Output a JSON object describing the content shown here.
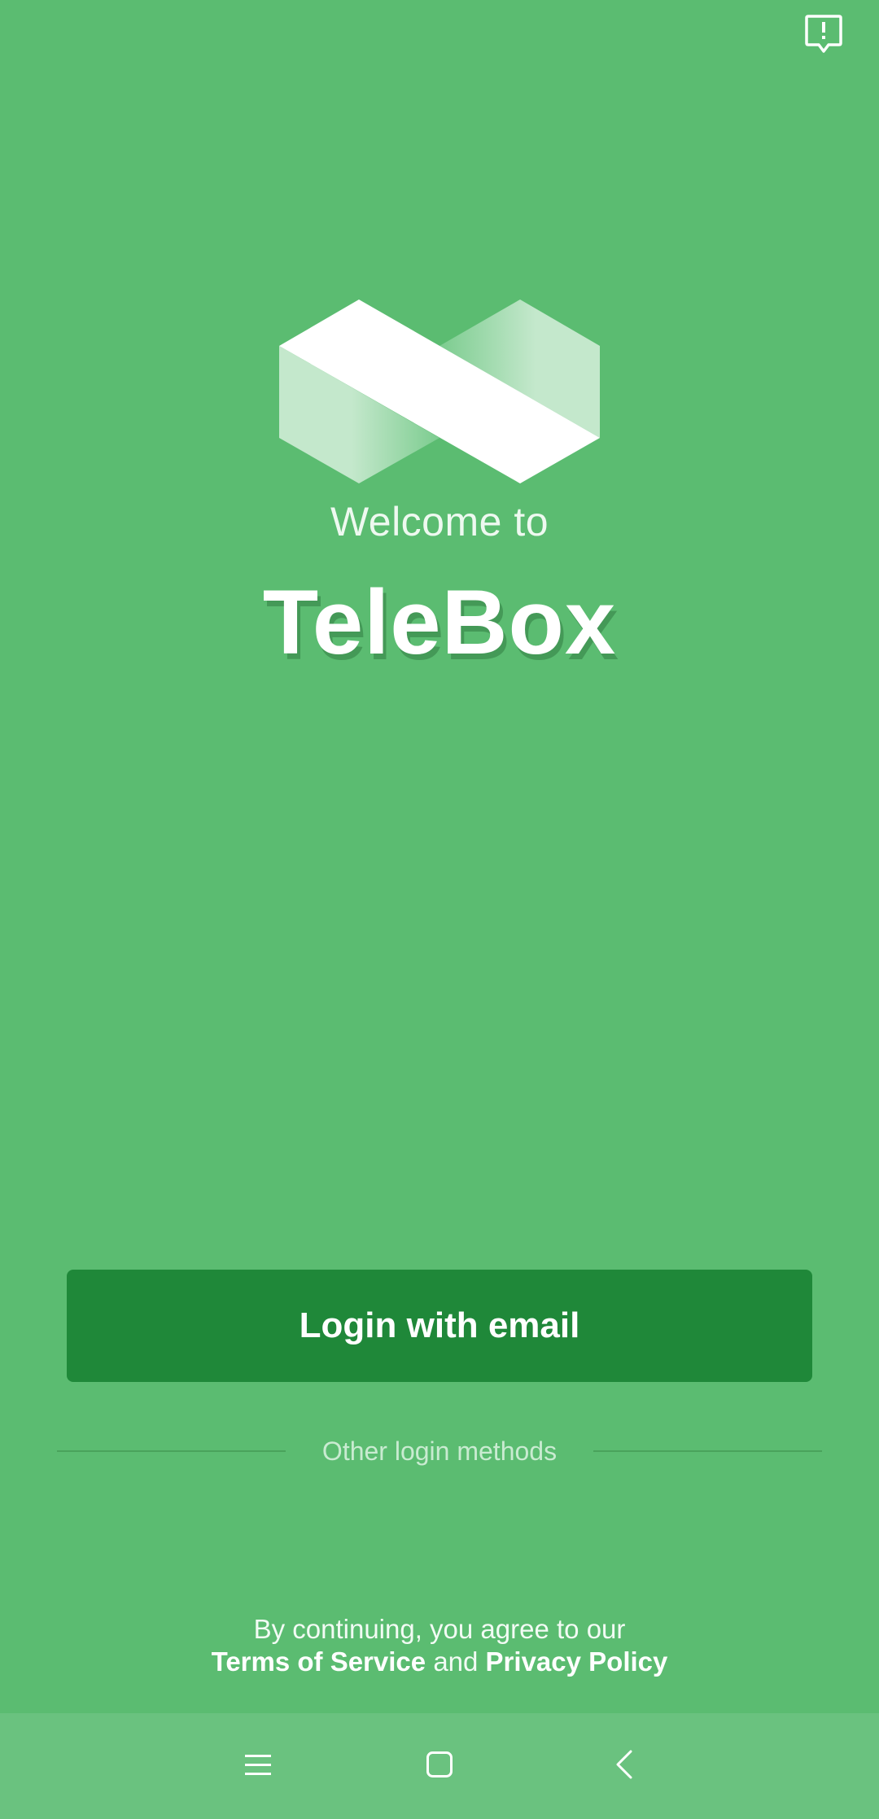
{
  "welcome": {
    "line1": "Welcome to",
    "brand": "TeleBox"
  },
  "actions": {
    "login_email": "Login with email",
    "other_methods": "Other login methods"
  },
  "legal": {
    "prefix": "By continuing, you agree to our",
    "terms": "Terms of Service",
    "conjunction": "and",
    "privacy": "Privacy Policy"
  },
  "icons": {
    "top_right": "feedback-icon",
    "nav": [
      "menu-icon",
      "home-icon",
      "back-icon"
    ]
  },
  "colors": {
    "background": "#5bbc71",
    "primary_button": "#1f8839",
    "navbar": "#6ac27f"
  }
}
